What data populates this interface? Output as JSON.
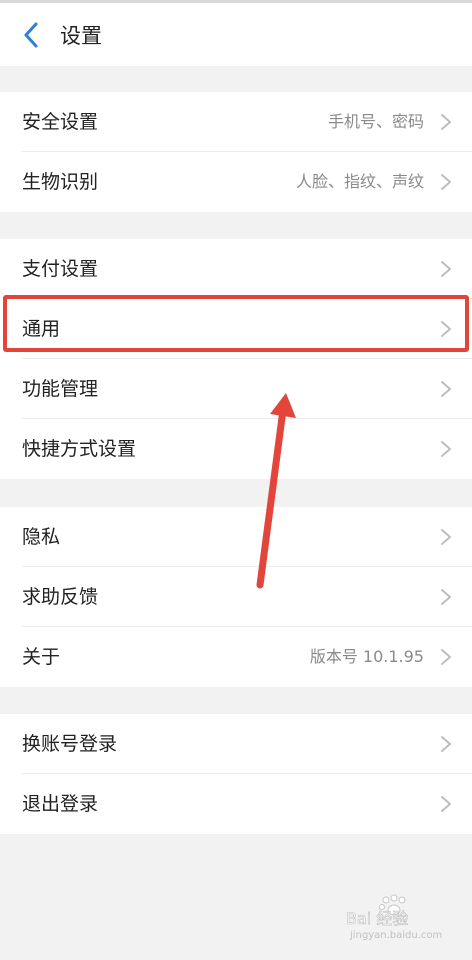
{
  "header": {
    "title": "设置",
    "back_icon": "back-chevron-icon"
  },
  "groups": [
    {
      "items": [
        {
          "label": "安全设置",
          "value": "手机号、密码"
        },
        {
          "label": "生物识别",
          "value": "人脸、指纹、声纹"
        }
      ]
    },
    {
      "items": [
        {
          "label": "支付设置",
          "value": ""
        },
        {
          "label": "通用",
          "value": ""
        },
        {
          "label": "功能管理",
          "value": ""
        },
        {
          "label": "快捷方式设置",
          "value": ""
        }
      ]
    },
    {
      "items": [
        {
          "label": "隐私",
          "value": ""
        },
        {
          "label": "求助反馈",
          "value": ""
        },
        {
          "label": "关于",
          "value": "版本号 10.1.95"
        }
      ]
    },
    {
      "items": [
        {
          "label": "换账号登录",
          "value": ""
        },
        {
          "label": "退出登录",
          "value": ""
        }
      ]
    }
  ],
  "annotation": {
    "highlighted_item": "通用",
    "highlight_color": "#e2463b"
  },
  "watermark": {
    "brand": "Bai 经验",
    "url": "jingyan.baidu.com"
  }
}
